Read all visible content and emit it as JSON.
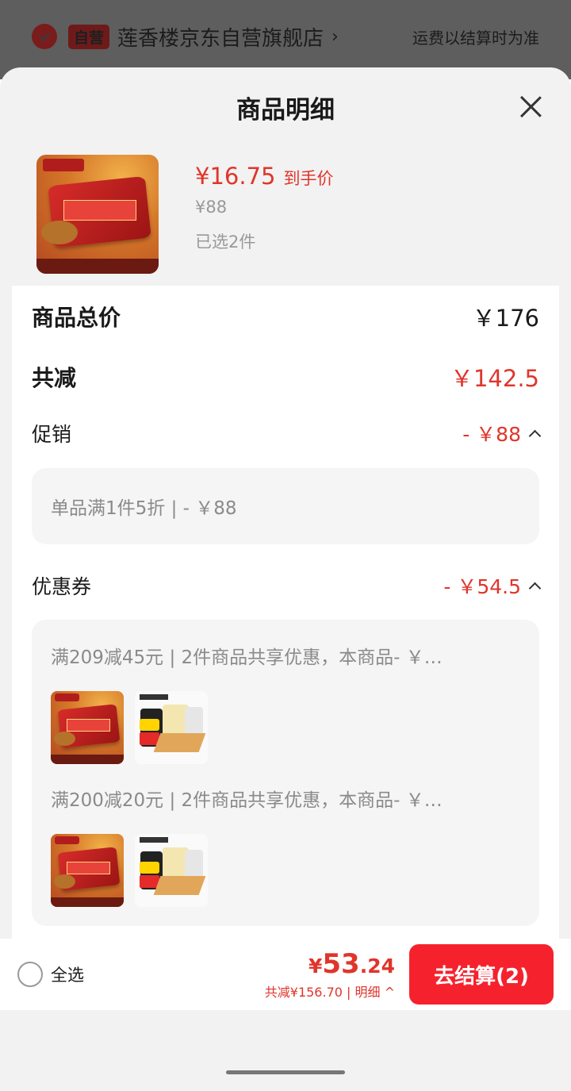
{
  "store": {
    "badge": "自营",
    "name": "莲香楼京东自营旗舰店",
    "shipping_note": "运费以结算时为准"
  },
  "sheet": {
    "title": "商品明细"
  },
  "product": {
    "price": "¥16.75",
    "price_label": "到手价",
    "original_price": "¥88",
    "selected": "已选2件"
  },
  "summary": {
    "total_label": "商品总价",
    "total_value": "￥176",
    "discount_label": "共减",
    "discount_value": "￥142.5",
    "promo_label": "促销",
    "promo_value": "- ￥88",
    "promo_detail": "单品满1件5折 | - ￥88",
    "coupon_label": "优惠券",
    "coupon_value": "- ￥54.5",
    "coupons": [
      {
        "text": "满209减45元 | 2件商品共享优惠，本商品- ￥…"
      },
      {
        "text": "满200减20元 | 2件商品共享优惠，本商品- ￥…"
      }
    ]
  },
  "footer": {
    "select_all": "全选",
    "currency": "¥",
    "total_int": "53",
    "total_dec": ".24",
    "sub_text": "共减¥156.70 | 明细 ^",
    "checkout": "去结算(2)"
  }
}
